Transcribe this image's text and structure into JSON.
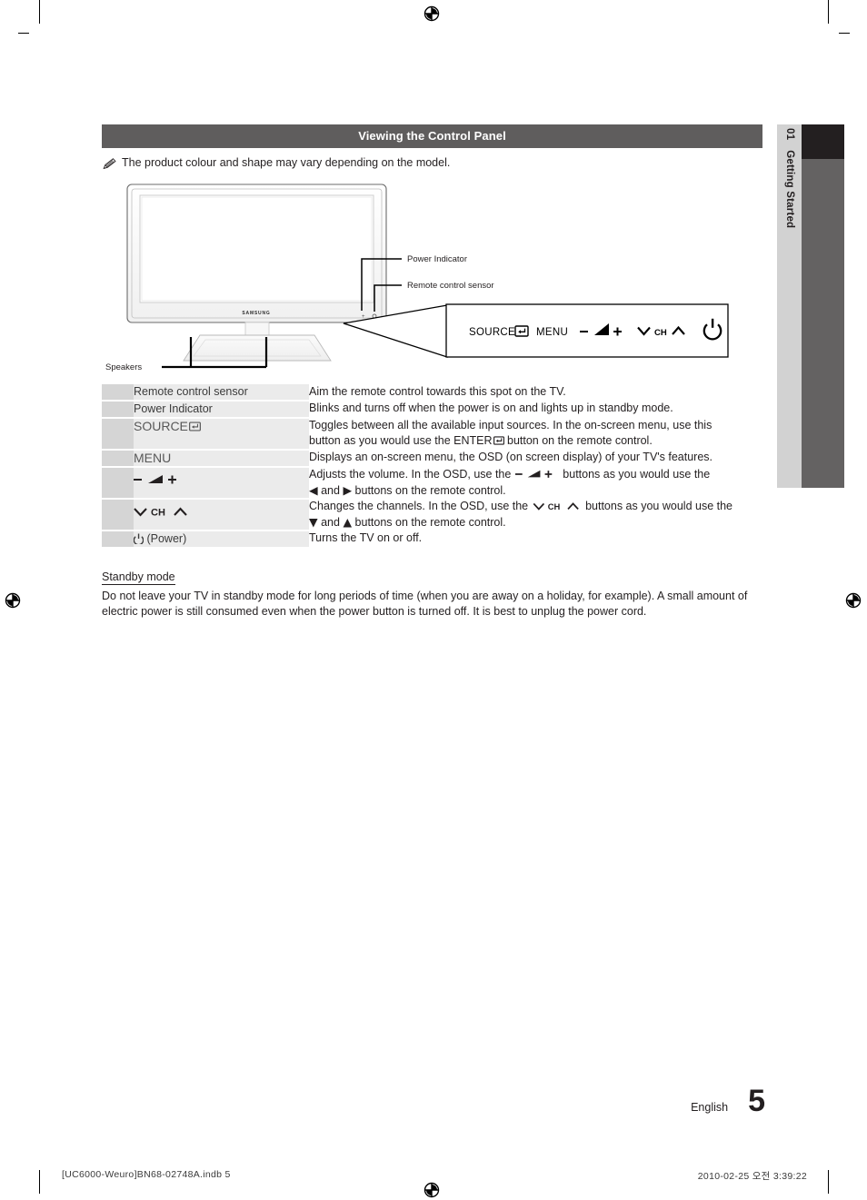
{
  "side_tab": {
    "chapter_number": "01",
    "chapter_title": "Getting Started"
  },
  "section": {
    "header": "Viewing the Control Panel",
    "note": "The product colour and shape may vary depending on the model.",
    "note_icon": "pencil-note-icon"
  },
  "diagram": {
    "brand": "SAMSUNG",
    "callouts": {
      "power_indicator": "Power Indicator",
      "remote_control_sensor": "Remote control sensor",
      "speakers": "Speakers"
    },
    "control_panel_buttons": [
      "SOURCE",
      "MENU",
      "−",
      "+",
      "CH",
      "power"
    ]
  },
  "table": {
    "rows": [
      {
        "label": "Remote control sensor",
        "label_style": "normal",
        "desc_lines": [
          "Aim the remote control towards this spot on the TV."
        ]
      },
      {
        "label": "Power Indicator",
        "label_style": "normal",
        "desc_lines": [
          "Blinks and turns off when the power is on and lights up in standby mode."
        ]
      },
      {
        "label": "SOURCE",
        "label_style": "big-with-enter-icon",
        "desc_lines": [
          "Toggles between all the available input sources. In the on-screen menu, use this",
          "button as you would use the ENTER  button on the remote control."
        ]
      },
      {
        "label": "MENU",
        "label_style": "big",
        "desc_lines": [
          "Displays an on-screen menu, the OSD (on screen display) of your TV's features."
        ]
      },
      {
        "label": "−  ◢  +",
        "label_style": "volume-icon",
        "desc_lines": [
          "Adjusts the volume. In the OSD, use the − ◢ + buttons as you would use the",
          "◀ and ▶ buttons on the remote control."
        ]
      },
      {
        "label": "∨ CH ∧",
        "label_style": "channel-icon",
        "desc_lines": [
          "Changes the channels. In the OSD, use the ∨ CH ∧ buttons as you would use the",
          "▼ and ▲ buttons on the remote control."
        ]
      },
      {
        "label": "(Power)",
        "label_style": "power-icon",
        "desc_lines": [
          "Turns the TV on or off."
        ]
      }
    ]
  },
  "standby": {
    "heading": "Standby mode",
    "body": "Do not leave your TV in standby mode for long periods of time (when you are away on a holiday, for example). A small amount of electric power is still consumed even when the power button is turned off. It is best to unplug the power cord."
  },
  "footer": {
    "language": "English",
    "page_number": "5"
  },
  "print_footer": {
    "file": "[UC6000-Weuro]BN68-02748A.indb   5",
    "timestamp": "2010-02-25   오전 3:39:22"
  },
  "colors": {
    "header_bar": "#5f5d5d",
    "tab_light": "#d2d2d2",
    "tab_dark": "#231f20",
    "tab_mid": "#646262",
    "row_swatch": "#d5d5d5",
    "row_label": "#ebebeb",
    "text": "#231f20"
  }
}
